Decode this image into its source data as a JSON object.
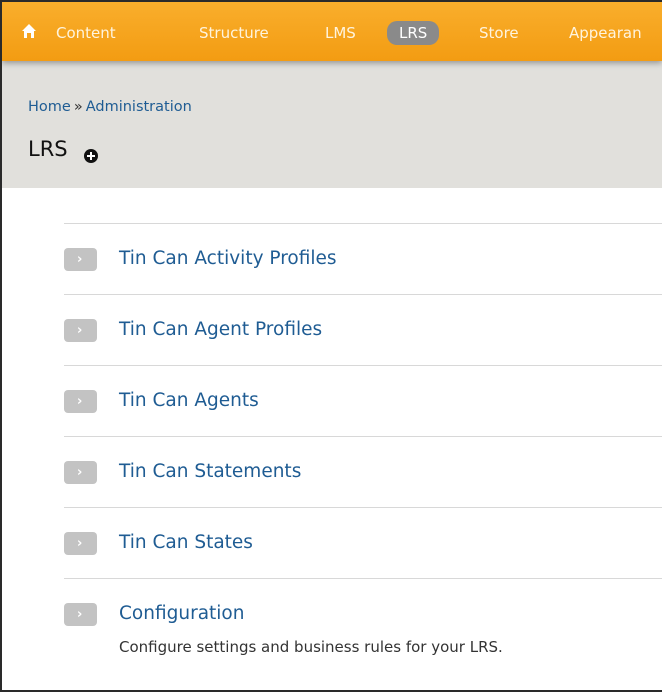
{
  "toolbar": {
    "items": [
      {
        "label": "Content",
        "active": false
      },
      {
        "label": "Structure",
        "active": false
      },
      {
        "label": "LMS",
        "active": false
      },
      {
        "label": "LRS",
        "active": true
      },
      {
        "label": "Store",
        "active": false
      },
      {
        "label": "Appearan",
        "active": false
      }
    ],
    "home_icon": "home-icon",
    "accent_color": "#f5a623"
  },
  "breadcrumb": {
    "home": "Home",
    "separator": "»",
    "administration": "Administration"
  },
  "page": {
    "title": "LRS",
    "add_icon": "plus-circle-icon"
  },
  "admin_list": [
    {
      "label": "Tin Can Activity Profiles",
      "description": ""
    },
    {
      "label": "Tin Can Agent Profiles",
      "description": ""
    },
    {
      "label": "Tin Can Agents",
      "description": ""
    },
    {
      "label": "Tin Can Statements",
      "description": ""
    },
    {
      "label": "Tin Can States",
      "description": ""
    },
    {
      "label": "Configuration",
      "description": "Configure settings and business rules for your LRS."
    }
  ],
  "colors": {
    "link": "#1f5c93",
    "header_bg": "#e1e0dc",
    "active_pill": "#8a8a8a"
  }
}
